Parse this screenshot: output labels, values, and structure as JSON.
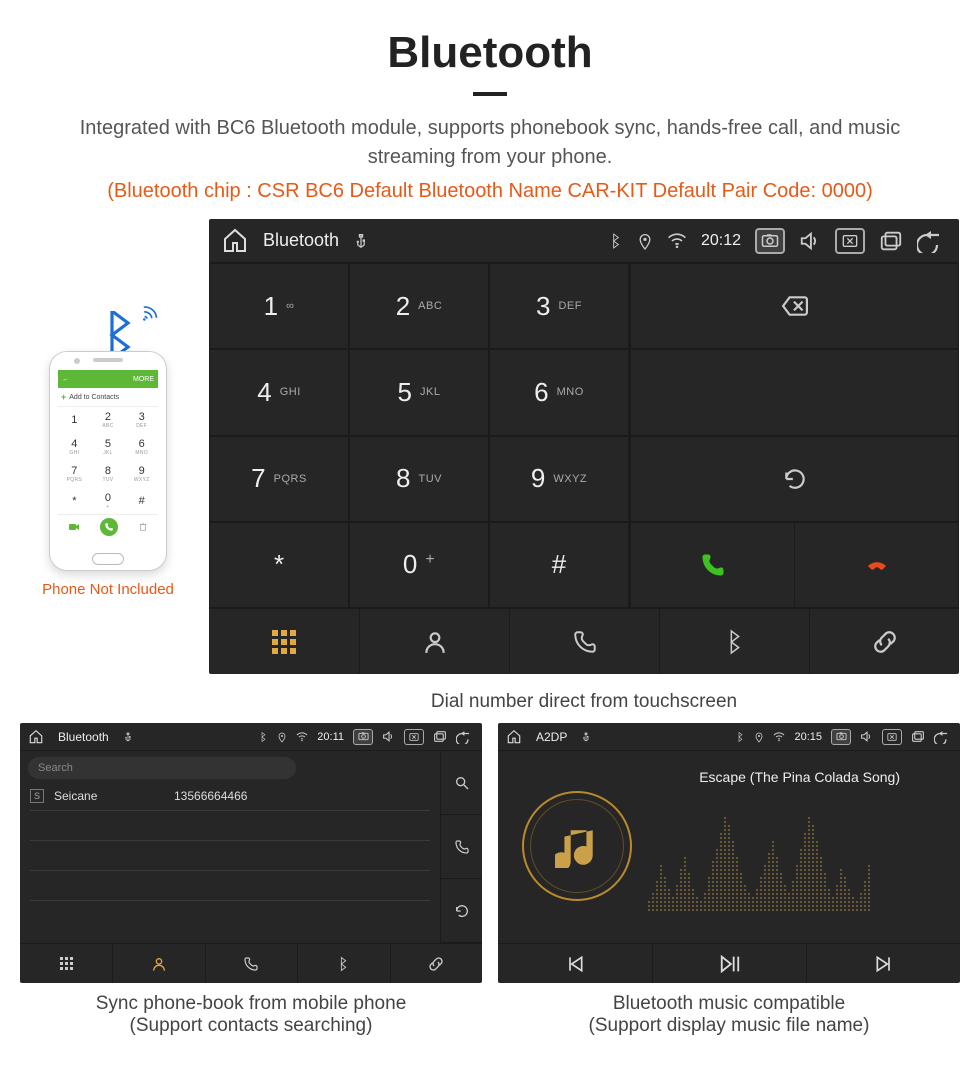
{
  "header": {
    "title": "Bluetooth"
  },
  "description": "Integrated with BC6 Bluetooth module, supports phonebook sync, hands-free call, and music streaming from your phone.",
  "specs": "(Bluetooth chip : CSR BC6    Default Bluetooth Name CAR-KIT    Default Pair Code: 0000)",
  "phone": {
    "topbar_left": "←",
    "topbar_right": "MORE",
    "add_contacts": "Add to Contacts",
    "keys": [
      {
        "n": "1",
        "l": ""
      },
      {
        "n": "2",
        "l": "ABC"
      },
      {
        "n": "3",
        "l": "DEF"
      },
      {
        "n": "4",
        "l": "GHI"
      },
      {
        "n": "5",
        "l": "JKL"
      },
      {
        "n": "6",
        "l": "MNO"
      },
      {
        "n": "7",
        "l": "PQRS"
      },
      {
        "n": "8",
        "l": "TUV"
      },
      {
        "n": "9",
        "l": "WXYZ"
      },
      {
        "n": "*",
        "l": ""
      },
      {
        "n": "0",
        "l": "+"
      },
      {
        "n": "#",
        "l": ""
      }
    ],
    "note": "Phone Not Included"
  },
  "dialer": {
    "title": "Bluetooth",
    "time": "20:12",
    "keys": [
      {
        "n": "1",
        "l": "∞"
      },
      {
        "n": "2",
        "l": "ABC"
      },
      {
        "n": "3",
        "l": "DEF"
      },
      {
        "n": "4",
        "l": "GHI"
      },
      {
        "n": "5",
        "l": "JKL"
      },
      {
        "n": "6",
        "l": "MNO"
      },
      {
        "n": "7",
        "l": "PQRS"
      },
      {
        "n": "8",
        "l": "TUV"
      },
      {
        "n": "9",
        "l": "WXYZ"
      },
      {
        "n": "*",
        "l": ""
      },
      {
        "n": "0",
        "l": "+",
        "sup": "+"
      },
      {
        "n": "#",
        "l": ""
      }
    ],
    "caption": "Dial number direct from touchscreen"
  },
  "contacts": {
    "title": "Bluetooth",
    "time": "20:11",
    "search_placeholder": "Search",
    "rows": [
      {
        "badge": "S",
        "name": "Seicane",
        "number": "13566664466"
      }
    ],
    "caption_line1": "Sync phone-book from mobile phone",
    "caption_line2": "(Support contacts searching)"
  },
  "music": {
    "title": "A2DP",
    "time": "20:15",
    "song": "Escape (The Pina Colada Song)",
    "caption_line1": "Bluetooth music compatible",
    "caption_line2": "(Support display music file name)"
  }
}
